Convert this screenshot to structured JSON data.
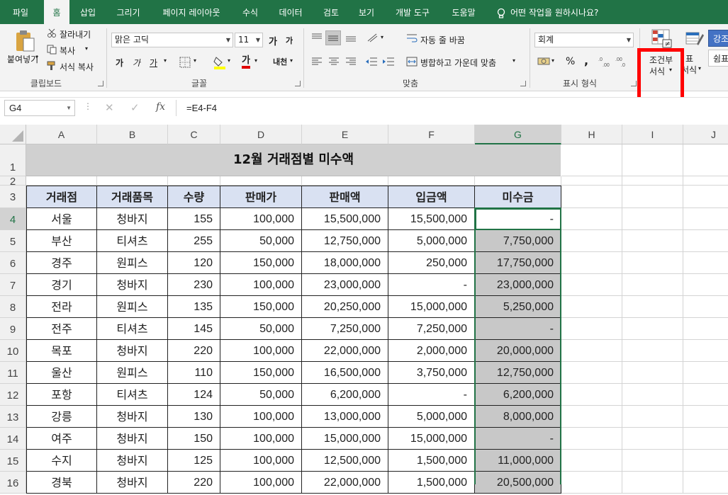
{
  "ribbon_tabs": [
    "파일",
    "홈",
    "삽입",
    "그리기",
    "페이지 레이아웃",
    "수식",
    "데이터",
    "검토",
    "보기",
    "개발 도구",
    "도움말"
  ],
  "tell_me": "어떤 작업을 원하시나요?",
  "clipboard": {
    "paste": "붙여넣기",
    "cut": "잘라내기",
    "copy": "복사",
    "format_painter": "서식 복사",
    "label": "클립보드"
  },
  "font": {
    "name": "맑은 고딕",
    "size": "11",
    "grow": "가",
    "shrink": "가",
    "bold": "가",
    "italic": "가",
    "underline": "가",
    "color_letter": "가",
    "phonetic": "내천",
    "label": "글꼴"
  },
  "alignment": {
    "wrap": "자동 줄 바꿈",
    "merge": "병합하고 가운데 맞춤",
    "label": "맞춤"
  },
  "number": {
    "format": "회계",
    "percent": "%",
    "comma": ",",
    "label": "표시 형식"
  },
  "styles": {
    "conditional_line1": "조건부",
    "conditional_line2": "서식",
    "table_line1": "표",
    "table_line2": "서식",
    "style1": "강조",
    "style2": "쉼표"
  },
  "formula_bar": {
    "name_box": "G4",
    "cancel": "✕",
    "enter": "✓",
    "fx": "fx",
    "formula": "=E4-F4"
  },
  "columns": [
    "A",
    "B",
    "C",
    "D",
    "E",
    "F",
    "G",
    "H",
    "I",
    "J"
  ],
  "row_numbers": [
    "1",
    "2",
    "3",
    "4",
    "5",
    "6",
    "7",
    "8",
    "9",
    "10",
    "11",
    "12",
    "13",
    "14",
    "15",
    "16"
  ],
  "sheet": {
    "title": "12월 거래점별 미수액",
    "headers": [
      "거래점",
      "거래품목",
      "수량",
      "판매가",
      "판매액",
      "입금액",
      "미수금"
    ],
    "rows": [
      [
        "서울",
        "청바지",
        "155",
        "100,000",
        "15,500,000",
        "15,500,000",
        "-"
      ],
      [
        "부산",
        "티셔츠",
        "255",
        "50,000",
        "12,750,000",
        "5,000,000",
        "7,750,000"
      ],
      [
        "경주",
        "원피스",
        "120",
        "150,000",
        "18,000,000",
        "250,000",
        "17,750,000"
      ],
      [
        "경기",
        "청바지",
        "230",
        "100,000",
        "23,000,000",
        "-",
        "23,000,000"
      ],
      [
        "전라",
        "원피스",
        "135",
        "150,000",
        "20,250,000",
        "15,000,000",
        "5,250,000"
      ],
      [
        "전주",
        "티셔츠",
        "145",
        "50,000",
        "7,250,000",
        "7,250,000",
        "-"
      ],
      [
        "목포",
        "청바지",
        "220",
        "100,000",
        "22,000,000",
        "2,000,000",
        "20,000,000"
      ],
      [
        "울산",
        "원피스",
        "110",
        "150,000",
        "16,500,000",
        "3,750,000",
        "12,750,000"
      ],
      [
        "포항",
        "티셔츠",
        "124",
        "50,000",
        "6,200,000",
        "-",
        "6,200,000"
      ],
      [
        "강릉",
        "청바지",
        "130",
        "100,000",
        "13,000,000",
        "5,000,000",
        "8,000,000"
      ],
      [
        "여주",
        "청바지",
        "150",
        "100,000",
        "15,000,000",
        "15,000,000",
        "-"
      ],
      [
        "수지",
        "청바지",
        "125",
        "100,000",
        "12,500,000",
        "1,500,000",
        "11,000,000"
      ],
      [
        "경북",
        "청바지",
        "220",
        "100,000",
        "22,000,000",
        "1,500,000",
        "20,500,000"
      ]
    ]
  },
  "colors": {
    "excel_green": "#217346",
    "header_fill": "#d9e1f2",
    "highlight_red": "#ff0000",
    "conditional_gray": "#c8c8c8"
  }
}
